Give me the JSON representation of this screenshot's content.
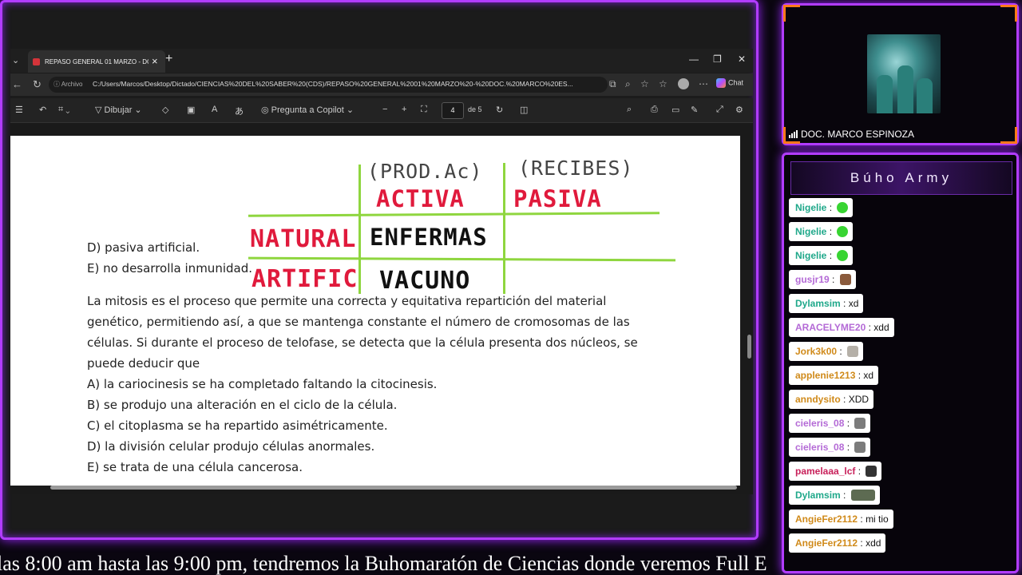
{
  "browser": {
    "tab_title": "REPASO GENERAL 01 MARZO - DO",
    "url_prefix": "Archivo",
    "url": "C:/Users/Marcos/Desktop/Dictado/CIENCIAS%20DEL%20SABER%20(CDS)/REPASO%20GENERAL%2001%20MARZO%20-%20DOC.%20MARCO%20ES...",
    "copilot_label": "Chat"
  },
  "pdf_toolbar": {
    "draw_label": "Dibujar",
    "copilot_label": "Pregunta a Copilot",
    "page_current": "4",
    "page_total": "de 5"
  },
  "document": {
    "lines": [
      "D) pasiva artificial.",
      "E) no desarrolla inmunidad.",
      "La mitosis es el proceso que permite una correcta y equitativa repartición del material",
      "genético, permitiendo así, a que se mantenga constante el número de cromosomas de las",
      "células. Si durante el proceso de telofase, se detecta que la célula presenta dos núcleos, se",
      "puede deducir que",
      "A) la cariocinesis se ha completado faltando la citocinesis.",
      "B) se produjo una alteración en el ciclo de la célula.",
      "C) el citoplasma se ha repartido asimétricamente.",
      "D) la división celular produjo células anormales.",
      "E) se trata de una célula cancerosa."
    ],
    "annotations": {
      "col1_note": "(PROD.Ac)",
      "col2_note": "(RECIBES)",
      "col1_header": "ACTIVA",
      "col2_header": "PASIVA",
      "row1_header": "NATURAL",
      "row2_header": "ARTIFIC",
      "cell_r1c1": "ENFERMAS",
      "cell_r2c1": "VACUNO"
    }
  },
  "ticker": "las 8:00 am hasta las 9:00 pm, tendremos la Buhomaratón de Ciencias donde veremos Full Ejercicios",
  "webcam": {
    "name": "DOC. MARCO ESPINOZA"
  },
  "chat": {
    "title": "Búho Army",
    "messages": [
      {
        "user": "Nigelie",
        "text": "",
        "emote": "green",
        "color": "#1fa88a"
      },
      {
        "user": "Nigelie",
        "text": "",
        "emote": "green",
        "color": "#1fa88a"
      },
      {
        "user": "Nigelie",
        "text": "",
        "emote": "green",
        "color": "#1fa88a"
      },
      {
        "user": "gusjr19",
        "text": "",
        "emote": "face",
        "color": "#b46ad6"
      },
      {
        "user": "Dylamsim",
        "text": "xd",
        "emote": "",
        "color": "#1fa88a"
      },
      {
        "user": "ARACELYME20",
        "text": "xdd",
        "emote": "",
        "color": "#b46ad6"
      },
      {
        "user": "Jork3k00",
        "text": "",
        "emote": "cat",
        "color": "#d08a1a"
      },
      {
        "user": "applenie1213",
        "text": "xd",
        "emote": "",
        "color": "#d08a1a"
      },
      {
        "user": "anndysito",
        "text": "XDD",
        "emote": "",
        "color": "#d08a1a"
      },
      {
        "user": "cieleris_08",
        "text": "",
        "emote": "gray",
        "color": "#b46ad6"
      },
      {
        "user": "cieleris_08",
        "text": "",
        "emote": "gray",
        "color": "#b46ad6"
      },
      {
        "user": "pamelaaa_lcf",
        "text": "",
        "emote": "dark",
        "color": "#c8205a"
      },
      {
        "user": "Dylamsim",
        "text": "",
        "emote": "wide",
        "color": "#1fa88a"
      },
      {
        "user": "AngieFer2112",
        "text": "mi tio",
        "emote": "",
        "color": "#d08a1a"
      },
      {
        "user": "AngieFer2112",
        "text": "xdd",
        "emote": "",
        "color": "#d08a1a"
      }
    ]
  },
  "colors": {
    "frame": "#b23cff",
    "accent": "#ff7a18",
    "annotation_red": "#e01a3c",
    "annotation_green": "#8fd63f"
  }
}
